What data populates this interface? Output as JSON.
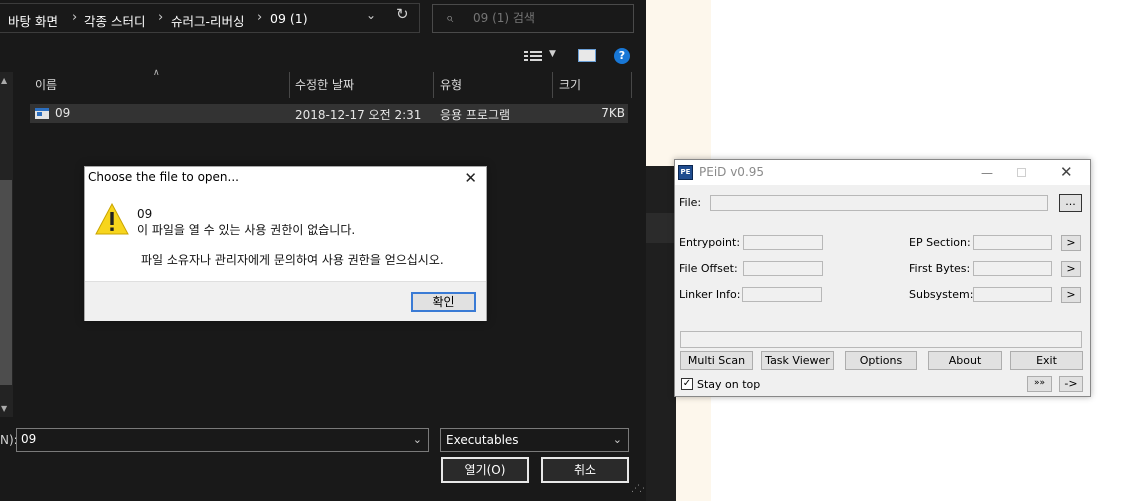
{
  "explorer": {
    "breadcrumbs": [
      "바탕 화면",
      "각종 스터디",
      "슈러그-리버싱",
      "09 (1)"
    ],
    "breadcrumb_separator": "›",
    "search_placeholder": "09 (1) 검색",
    "help_label": "?",
    "columns": [
      "이름",
      "수정한 날짜",
      "유형",
      "크기"
    ],
    "files": [
      {
        "name": "09",
        "modified": "2018-12-17 오전 2:31",
        "type": "응용 프로그램",
        "size": "7KB"
      }
    ],
    "filename_label": "N):",
    "filename_value": "09",
    "filetype_value": "Executables",
    "open_button": "열기(O)",
    "cancel_button": "취소"
  },
  "message_box": {
    "title": "Choose the file to open...",
    "line_file": "09",
    "line_error": "이 파일을 열 수 있는 사용 권한이 없습니다.",
    "line_help": "파일 소유자나 관리자에게 문의하여 사용 권한을 얻으십시오.",
    "ok_button": "확인"
  },
  "peid": {
    "title": "PEiD v0.95",
    "logo_text": "PE",
    "file_label": "File:",
    "browse_button": "...",
    "entrypoint_label": "Entrypoint:",
    "file_offset_label": "File Offset:",
    "linker_info_label": "Linker Info:",
    "ep_section_label": "EP Section:",
    "first_bytes_label": "First Bytes:",
    "subsystem_label": "Subsystem:",
    "arrow_button": ">",
    "buttons": [
      "Multi Scan",
      "Task Viewer",
      "Options",
      "About",
      "Exit"
    ],
    "stay_on_top_label": "Stay on top",
    "stay_on_top_checked": "✓",
    "extra_button": "»»",
    "next_button": "->"
  },
  "colors": {
    "explorer_bg": "#191919",
    "accent_blue": "#3a7bd5",
    "warning_yellow": "#f7d51d"
  }
}
